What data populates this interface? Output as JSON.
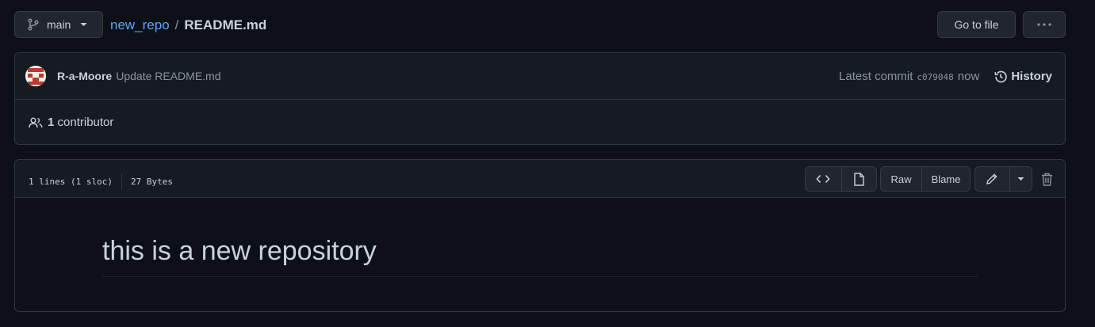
{
  "branch": {
    "name": "main",
    "icon": "git-branch-icon"
  },
  "breadcrumb": {
    "repo": "new_repo",
    "separator": "/",
    "file": "README.md"
  },
  "actions": {
    "goto_file": "Go to file",
    "more": "more-horizontal-icon"
  },
  "commit": {
    "author": "R-a-Moore",
    "message": "Update README.md",
    "latest_label": "Latest commit",
    "sha": "c079048",
    "time": "now",
    "history_label": "History"
  },
  "contributors": {
    "count": "1",
    "label": "contributor"
  },
  "file": {
    "lines": "1 lines (1 sloc)",
    "size": "27 Bytes",
    "raw_label": "Raw",
    "blame_label": "Blame"
  },
  "readme": {
    "heading": "this is a new repository"
  },
  "colors": {
    "accent": "#58a6ff",
    "background": "#0d1117",
    "surface": "#161b22",
    "border": "#30363d"
  }
}
